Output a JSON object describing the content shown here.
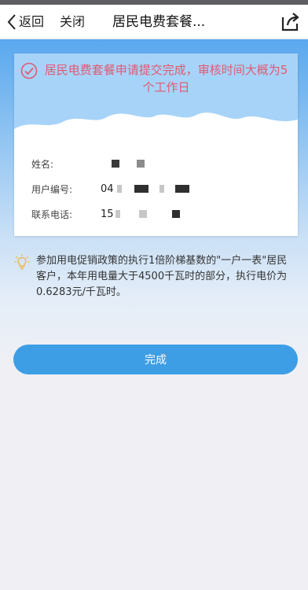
{
  "nav": {
    "back_label": "返回",
    "close_label": "关闭",
    "title": "居民电费套餐..."
  },
  "card": {
    "message": "居民电费套餐申请提交完成，审核时间大概为5个工作日",
    "fields": [
      {
        "label": "姓名:",
        "value": ""
      },
      {
        "label": "用户编号:",
        "value": "04"
      },
      {
        "label": "联系电话:",
        "value": "15"
      }
    ]
  },
  "notice": {
    "text": "参加用电促销政策的执行1倍阶梯基数的\"一户一表\"居民客户，本年用电量大于4500千瓦时的部分，执行电价为0.6283元/千瓦时。"
  },
  "actions": {
    "done_label": "完成"
  },
  "colors": {
    "accent": "#3d9ee6",
    "message_red": "#e25a70",
    "bulb_yellow": "#f0b43a"
  }
}
